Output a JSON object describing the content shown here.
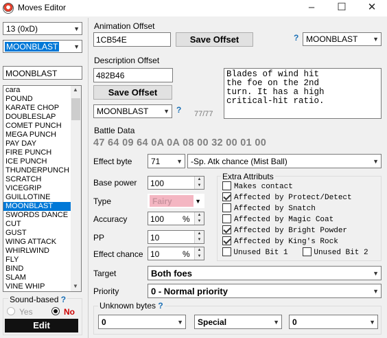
{
  "window": {
    "title": "Moves Editor"
  },
  "left": {
    "move_select": "13 (0xD)",
    "name_combo": "MOONBLAST",
    "name_field": "MOONBLAST",
    "moves": [
      "cara",
      "POUND",
      "KARATE CHOP",
      "DOUBLESLAP",
      "COMET PUNCH",
      "MEGA PUNCH",
      "PAY DAY",
      "FIRE PUNCH",
      "ICE PUNCH",
      "THUNDERPUNCH",
      "SCRATCH",
      "VICEGRIP",
      "GUILLOTINE",
      "MOONBLAST",
      "SWORDS DANCE",
      "CUT",
      "GUST",
      "WING ATTACK",
      "WHIRLWIND",
      "FLY",
      "BIND",
      "SLAM",
      "VINE WHIP"
    ],
    "selected_index": 13,
    "sound_label": "Sound-based",
    "sound_help": "?",
    "yes_label": "Yes",
    "no_label": "No",
    "edit_label": "Edit"
  },
  "animation": {
    "label": "Animation Offset",
    "offset": "1CB54E",
    "save_label": "Save Offset",
    "help": "?",
    "combo": "MOONBLAST"
  },
  "description": {
    "label": "Description Offset",
    "offset": "482B46",
    "save_label": "Save Offset",
    "combo": "MOONBLAST",
    "help": "?",
    "count": "77/77",
    "text": "Blades of wind hit\nthe foe on the 2nd\nturn. It has a high\ncritical-hit ratio."
  },
  "battle": {
    "label": "Battle Data",
    "bytes": "47 64 09 64 0A 0A 08 00 32 00 01 00",
    "effect_label": "Effect byte",
    "effect_value": "71",
    "effect_desc": "-Sp. Atk chance (Mist Ball)",
    "power_label": "Base power",
    "power": "100",
    "type_label": "Type",
    "type": "Fairy",
    "accuracy_label": "Accuracy",
    "accuracy": "100",
    "percent": "%",
    "pp_label": "PP",
    "pp": "10",
    "chance_label": "Effect chance",
    "chance": "10",
    "target_label": "Target",
    "target": "Both foes",
    "priority_label": "Priority",
    "priority": "0 - Normal priority"
  },
  "extra": {
    "label": "Extra Attributs",
    "items": [
      {
        "label": "Makes contact",
        "checked": false
      },
      {
        "label": "Affected by Protect/Detect",
        "checked": true
      },
      {
        "label": "Affected by Snatch",
        "checked": false
      },
      {
        "label": "Affected by Magic Coat",
        "checked": false
      },
      {
        "label": "Affected by Bright Powder",
        "checked": true
      },
      {
        "label": "Affected by King's Rock",
        "checked": true
      }
    ],
    "unused1": "Unused Bit 1",
    "unused2": "Unused Bit 2"
  },
  "unknown": {
    "label": "Unknown bytes",
    "help": "?",
    "a": "0",
    "b": "Special",
    "c": "0"
  },
  "colors": {
    "selection": "#0078d7",
    "fairy": "#f4b6c2",
    "help": "#1a6fb5"
  }
}
